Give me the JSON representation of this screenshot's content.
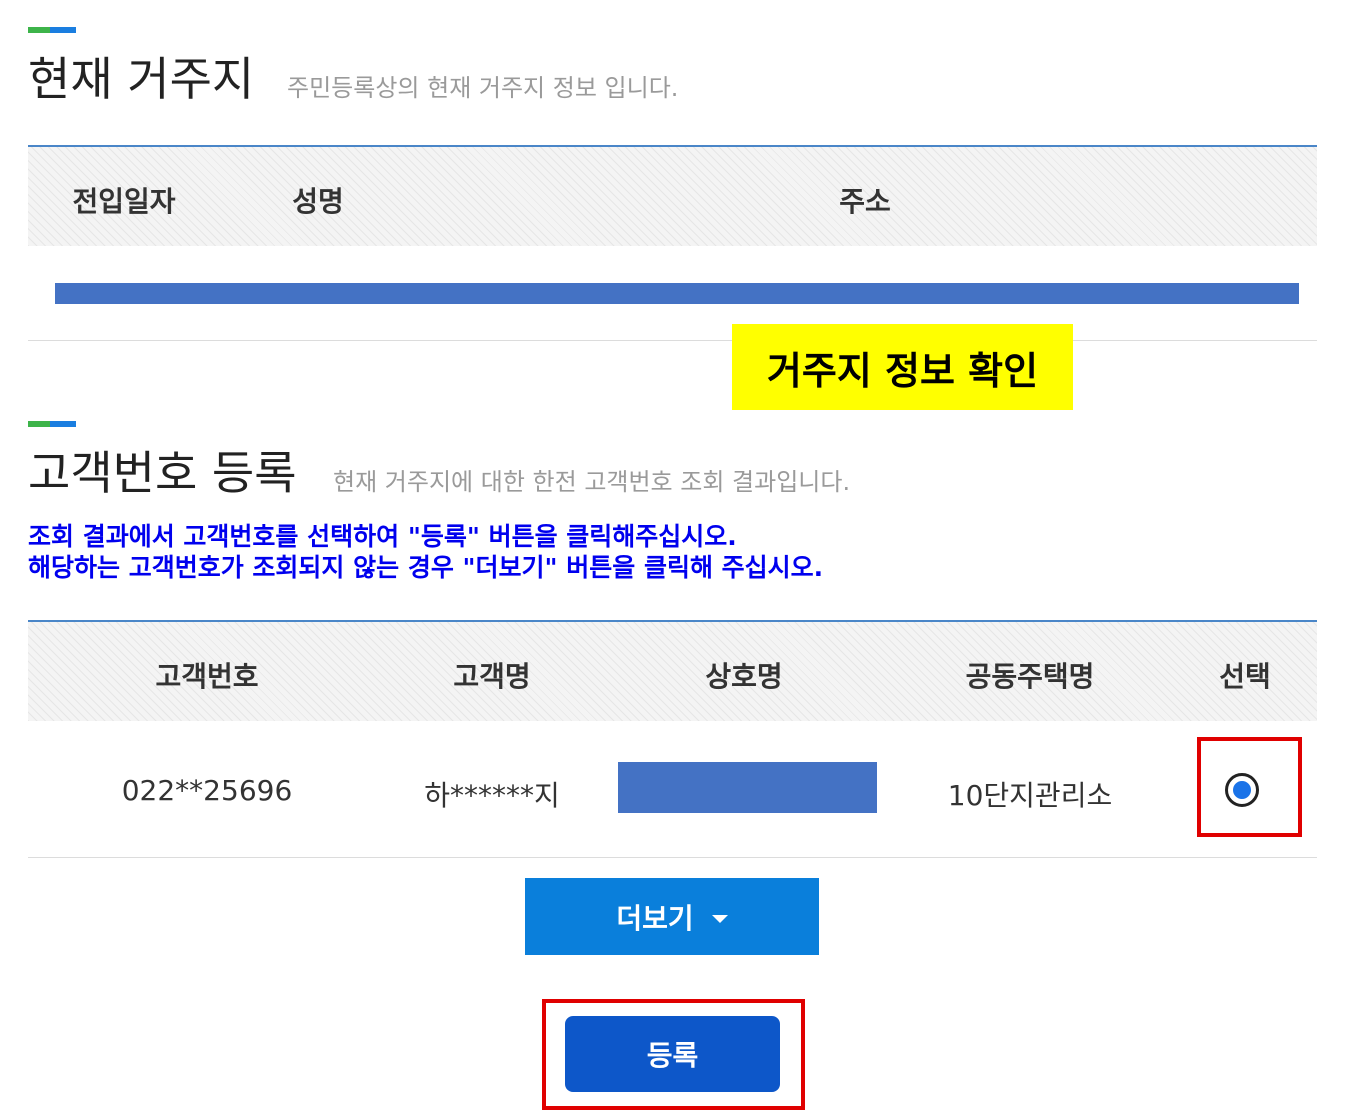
{
  "residence": {
    "title": "현재 거주지",
    "subtitle": "주민등록상의 현재 거주지 정보 입니다.",
    "columns": [
      "전입일자",
      "성명",
      "주소"
    ],
    "callout": "거주지 정보 확인"
  },
  "customer": {
    "title": "고객번호 등록",
    "subtitle": "현재 거주지에 대한 한전 고객번호 조회 결과입니다.",
    "instructions": [
      "조회 결과에서 고객번호를 선택하여 \"등록\" 버튼을 클릭해주십시오.",
      "해당하는 고객번호가 조회되지 않는 경우 \"더보기\" 버튼을 클릭해 주십시오."
    ],
    "columns": [
      "고객번호",
      "고객명",
      "상호명",
      "공동주택명",
      "선택"
    ],
    "row": {
      "customer_no": "022**25696",
      "customer_name": "하******지",
      "complex_name": "10단지관리소",
      "selected": true
    },
    "more_label": "더보기",
    "register_label": "등록"
  },
  "colors": {
    "accent_green": "#3db44a",
    "accent_blue": "#1a7ee0",
    "mask": "#4472c4",
    "callout_bg": "#ffff00",
    "instruction_text": "#0000ee",
    "highlight_box": "#e00000",
    "more_button": "#0a7fdb",
    "register_button": "#0d57c9"
  }
}
